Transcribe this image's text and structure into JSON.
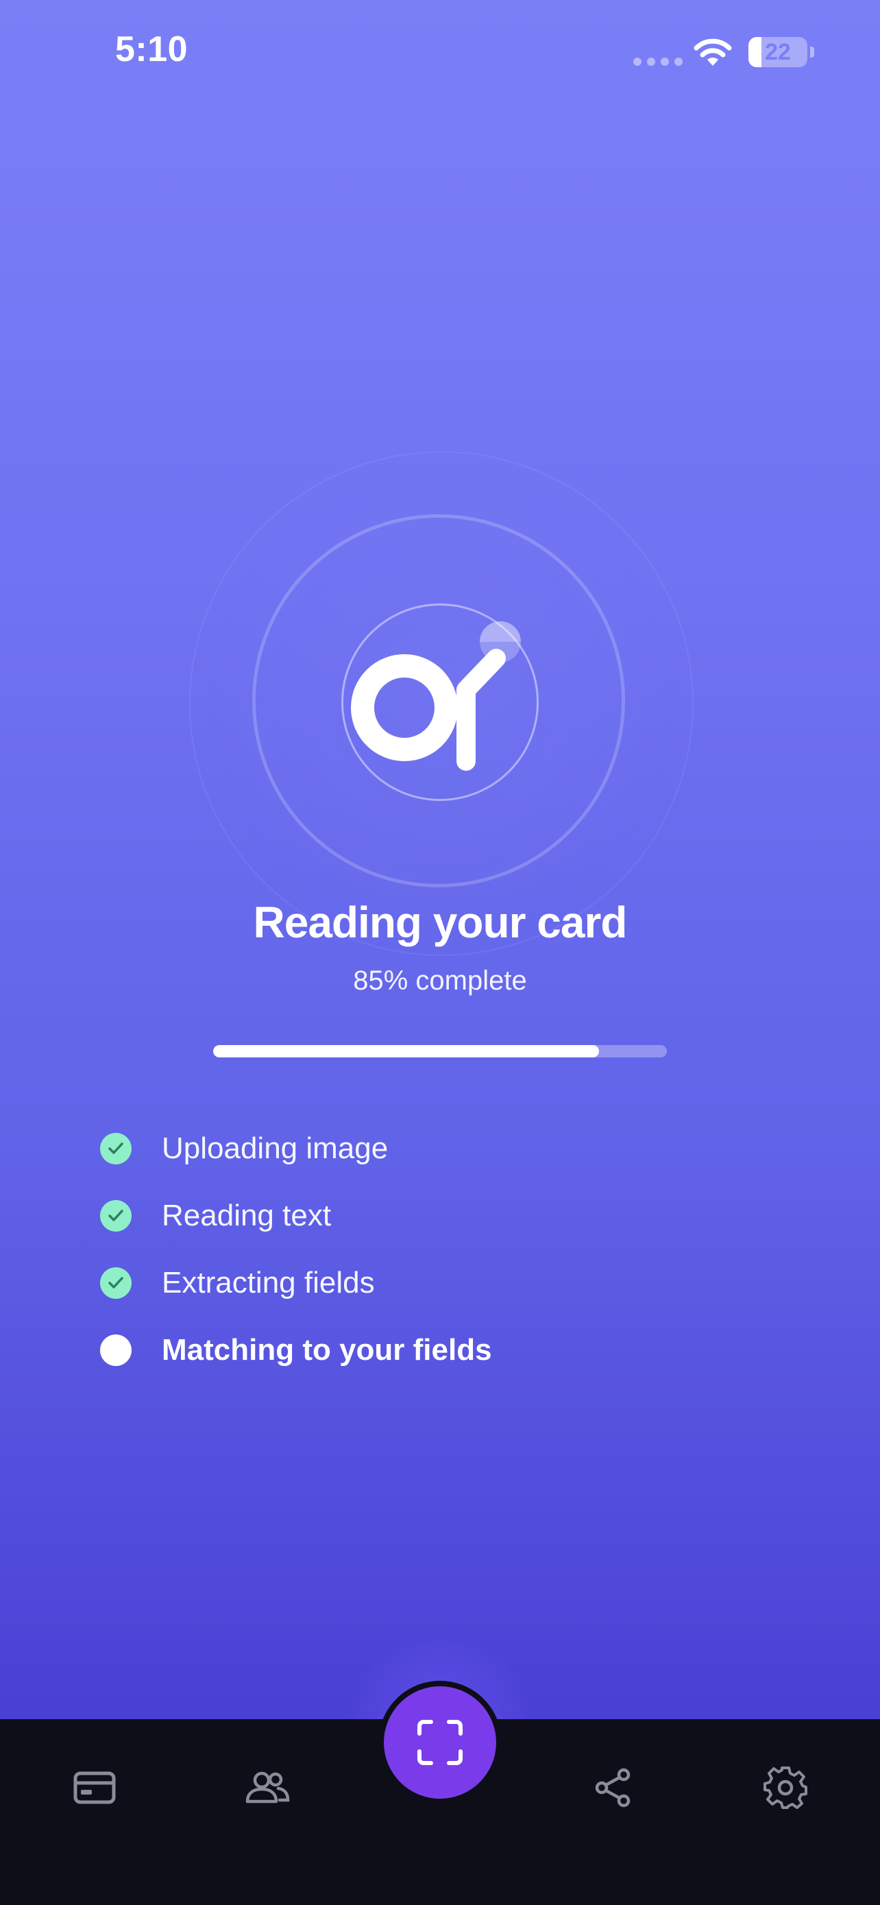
{
  "status_bar": {
    "time": "5:10",
    "battery_level": "22",
    "battery_fraction": 0.22
  },
  "loader": {
    "title": "Reading your card",
    "progress_text": "85% complete",
    "progress_value": 0.85
  },
  "steps": [
    {
      "label": "Uploading image",
      "state": "done"
    },
    {
      "label": "Reading text",
      "state": "done"
    },
    {
      "label": "Extracting fields",
      "state": "done"
    },
    {
      "label": "Matching to your fields",
      "state": "current"
    }
  ],
  "tab_bar": {
    "items": [
      {
        "icon": "card-icon"
      },
      {
        "icon": "contacts-icon"
      },
      {
        "icon": "scan-icon"
      },
      {
        "icon": "share-icon"
      },
      {
        "icon": "settings-icon"
      }
    ]
  },
  "colors": {
    "background_top": "#7B7FF6",
    "background_bottom": "#473DD0",
    "check_green": "#8FF0C8",
    "fab_purple": "#7A3CEB",
    "tab_bar": "#0D0E18",
    "tab_icon": "#8A8C9A"
  }
}
